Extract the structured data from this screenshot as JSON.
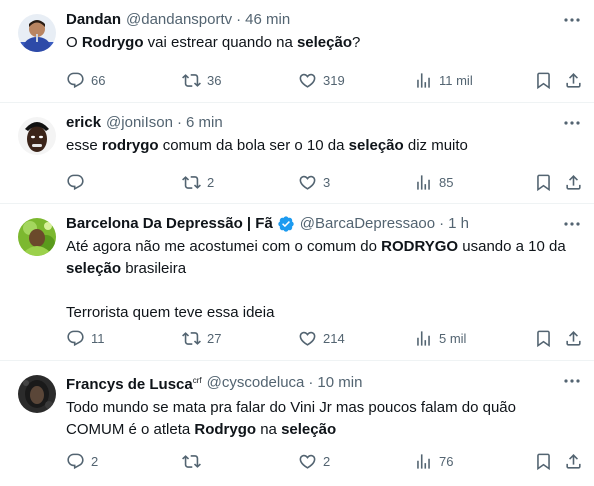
{
  "tweets": [
    {
      "name": "Dandan",
      "handle": "@dandansportv",
      "dot": "·",
      "time": "46 min",
      "text": [
        {
          "t": "O "
        },
        {
          "b": "Rodrygo"
        },
        {
          "t": " vai estrear quando na "
        },
        {
          "b": "seleção"
        },
        {
          "t": "?"
        }
      ],
      "replies": "66",
      "retweets": "36",
      "likes": "319",
      "views": "11 mil"
    },
    {
      "name": "erick",
      "handle": "@joniIson",
      "dot": "·",
      "time": "6 min",
      "text": [
        {
          "t": "esse "
        },
        {
          "b": "rodrygo"
        },
        {
          "t": " comum da bola ser o 10 da "
        },
        {
          "b": "seleção"
        },
        {
          "t": " diz muito"
        }
      ],
      "replies": "",
      "retweets": "2",
      "likes": "3",
      "views": "85"
    },
    {
      "name": "Barcelona Da Depressão | Fã",
      "verified": true,
      "handle": "@BarcaDepressaoo",
      "dot": "·",
      "time": "1 h",
      "text": [
        {
          "t": "Até agora não me acostumei com o comum do "
        },
        {
          "b": "RODRYGO"
        },
        {
          "t": " usando a 10 da\n"
        },
        {
          "b": "seleção"
        },
        {
          "t": " brasileira\n\nTerrorista quem teve essa ideia"
        }
      ],
      "replies": "11",
      "retweets": "27",
      "likes": "214",
      "views": "5 mil"
    },
    {
      "name": "Francys de Lusca",
      "name_sup": "crf",
      "handle": "@cyscodeluca",
      "dot": "·",
      "time": "10 min",
      "text": [
        {
          "t": "Todo mundo se mata pra falar do Vini Jr mas poucos falam do quão\nCOMUM é o atleta "
        },
        {
          "b": "Rodrygo"
        },
        {
          "t": " na "
        },
        {
          "b": "seleção"
        }
      ],
      "replies": "2",
      "retweets": "",
      "likes": "2",
      "views": "76"
    }
  ],
  "colors": {
    "text": "#0f1419",
    "secondary": "#536471",
    "verified": "#1d9bf0",
    "divider": "#eff3f4"
  },
  "icons": [
    "reply-icon",
    "retweet-icon",
    "like-icon",
    "views-icon",
    "bookmark-icon",
    "share-icon",
    "more-icon",
    "verified-badge-icon"
  ]
}
